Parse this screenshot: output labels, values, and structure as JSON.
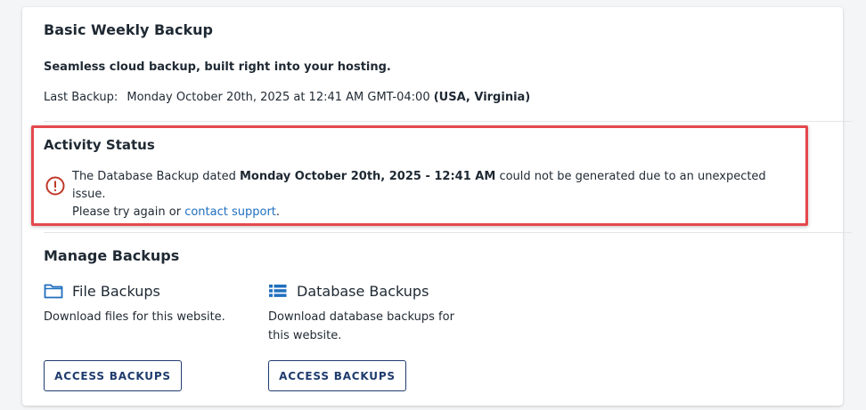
{
  "header": {
    "title": "Basic Weekly Backup",
    "tagline": "Seamless cloud backup, built right into your hosting.",
    "last_backup_label": "Last Backup:",
    "last_backup_value": "Monday October 20th, 2025 at 12:41 AM GMT-04:00",
    "last_backup_region": "(USA, Virginia)"
  },
  "activity": {
    "title": "Activity Status",
    "message_prefix": "The Database Backup dated",
    "message_date": "Monday October 20th, 2025 - 12:41 AM",
    "message_suffix": "could not be generated due to an unexpected issue.",
    "retry_prefix": "Please try again or",
    "support_link": "contact support",
    "retry_suffix": ".",
    "icon": "error-circle-icon",
    "highlight_color": "#e5484d"
  },
  "manage": {
    "title": "Manage Backups",
    "file": {
      "icon": "folder-icon",
      "label": "File Backups",
      "description": "Download files for this website.",
      "button": "ACCESS BACKUPS"
    },
    "database": {
      "icon": "database-list-icon",
      "label": "Database Backups",
      "description": "Download database backups for this website.",
      "button": "ACCESS BACKUPS"
    }
  },
  "colors": {
    "accent": "#1f6fbf",
    "button_border": "#1f3c6e",
    "error": "#c0392b"
  }
}
